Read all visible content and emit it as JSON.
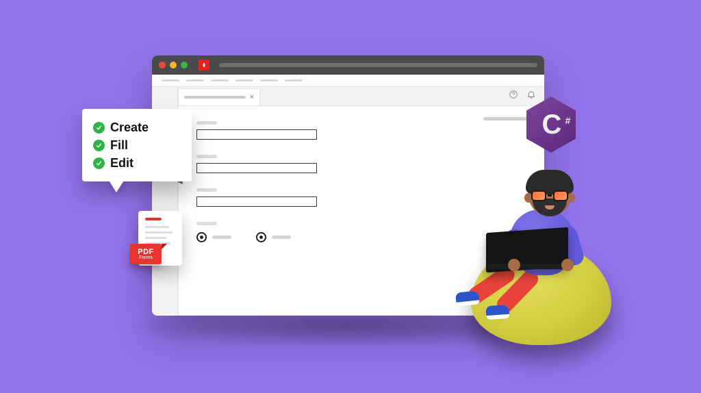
{
  "callout": {
    "items": [
      "Create",
      "Fill",
      "Edit"
    ]
  },
  "pdf_flag": {
    "line1": "PDF",
    "line2": "Forms"
  },
  "csharp": {
    "letter": "C",
    "hash": "#"
  },
  "window": {
    "menu_item_count": 6,
    "tools": [
      "copy-icon",
      "attachment-icon",
      "layers-icon"
    ],
    "fields": [
      {
        "label": "",
        "value": ""
      },
      {
        "label": "",
        "value": ""
      },
      {
        "label": "",
        "value": ""
      }
    ],
    "radios": [
      {
        "selected": true,
        "label": ""
      },
      {
        "selected": true,
        "label": ""
      }
    ]
  }
}
